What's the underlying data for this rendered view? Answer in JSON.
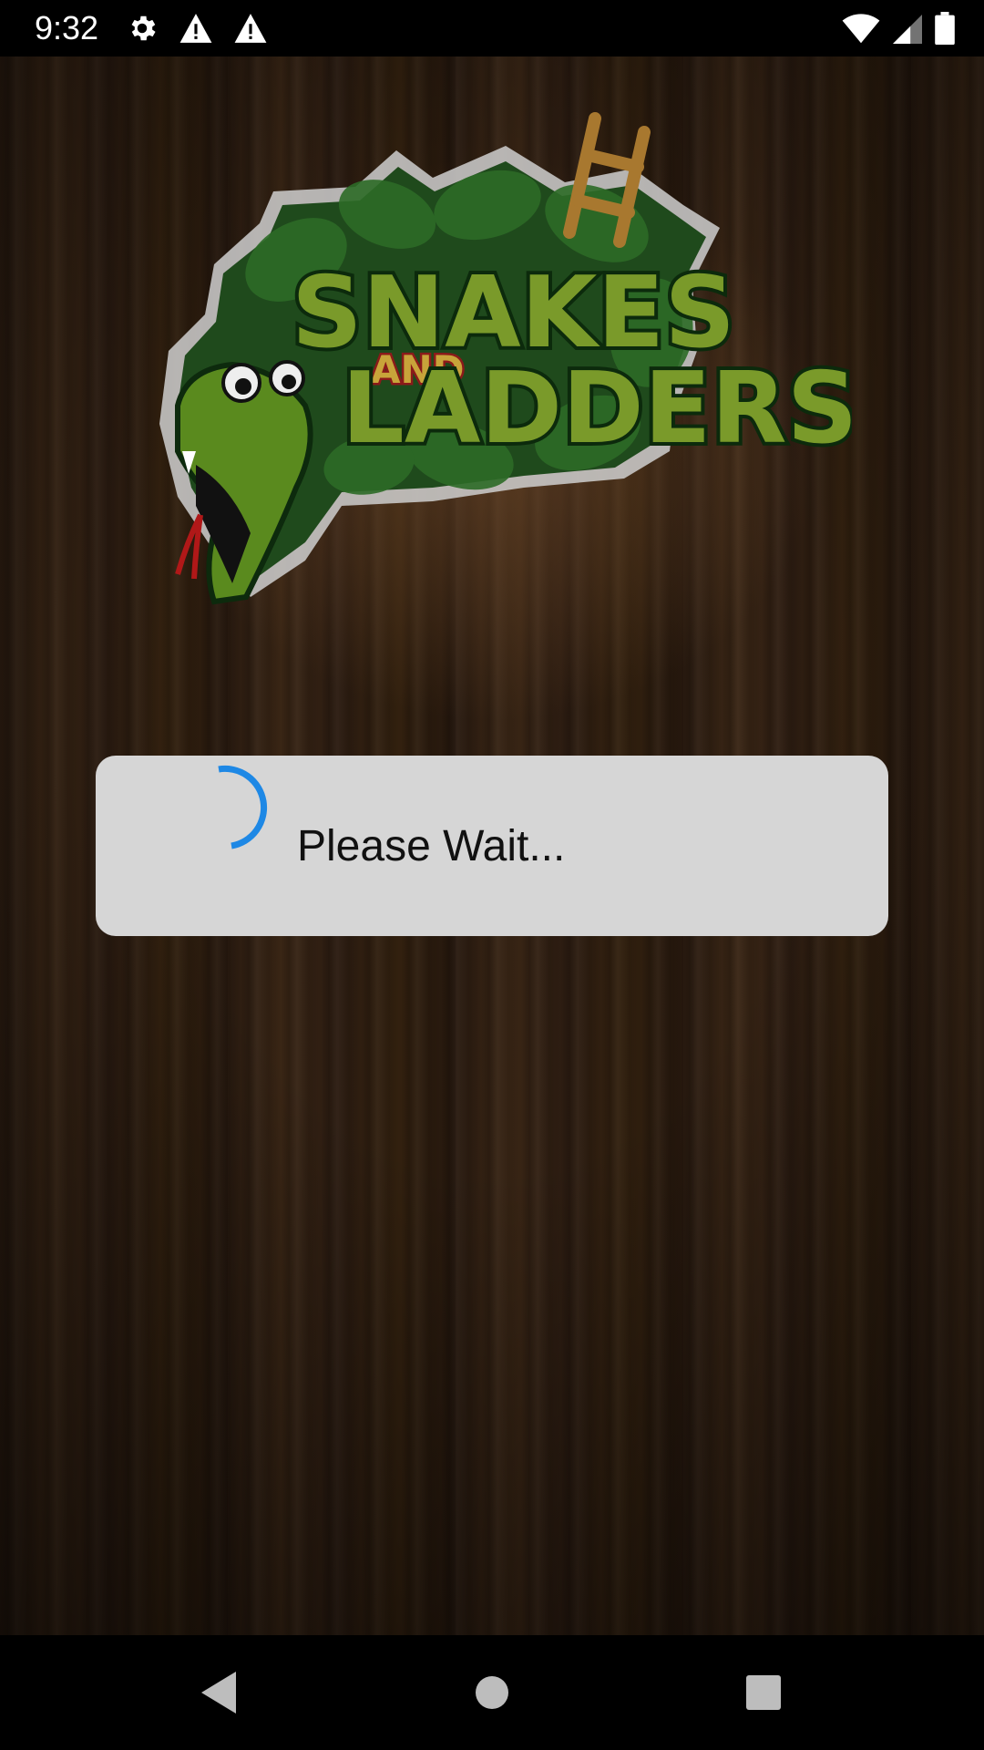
{
  "status_bar": {
    "time": "9:32",
    "left_icons": [
      "gear-icon",
      "warning-icon",
      "warning-icon"
    ],
    "right_icons": [
      "wifi-icon",
      "cell-signal-icon",
      "battery-icon"
    ]
  },
  "logo": {
    "title_top": "SNAKES",
    "title_and": "AND",
    "title_bottom": "LADDERS"
  },
  "dialog": {
    "message": "Please Wait...",
    "spinner_color": "#1e88e5"
  },
  "nav_bar": {
    "icons": [
      "back-icon",
      "home-icon",
      "recents-icon"
    ]
  }
}
